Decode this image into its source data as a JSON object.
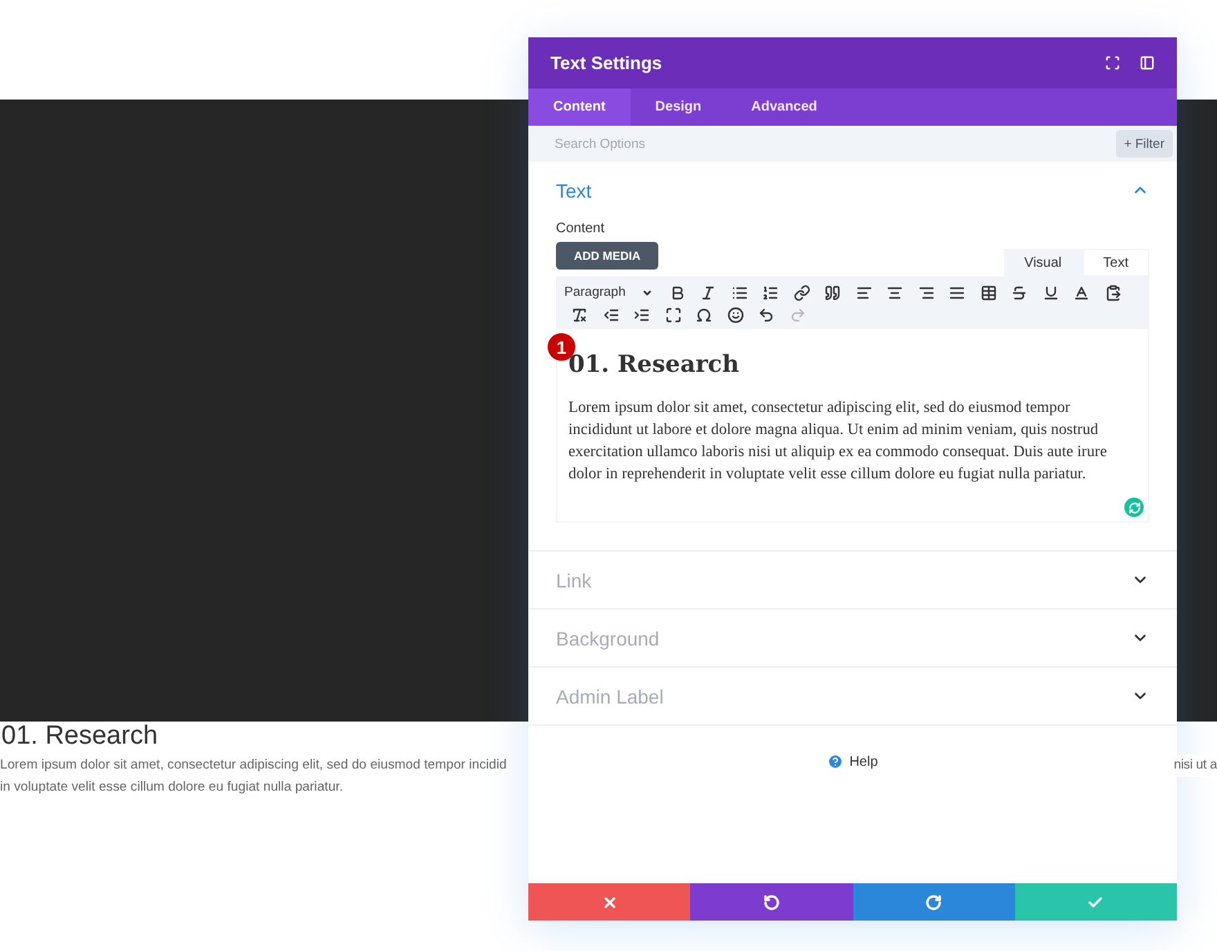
{
  "background_page": {
    "heading": "01. Research",
    "paragraph_lines": [
      "Lorem ipsum dolor sit amet, consectetur adipiscing elit, sed do eiusmod tempor incidid",
      "in voluptate velit esse cillum dolore eu fugiat nulla pariatur."
    ],
    "paragraph_fragment": "nisi ut a"
  },
  "modal": {
    "title": "Text Settings",
    "tabs": [
      {
        "label": "Content",
        "selected": true
      },
      {
        "label": "Design",
        "selected": false
      },
      {
        "label": "Advanced",
        "selected": false
      }
    ],
    "search": {
      "placeholder": "Search Options"
    },
    "filter_button": "+ Filter",
    "sections": [
      {
        "title": "Text",
        "expanded": true
      },
      {
        "title": "Link",
        "expanded": false
      },
      {
        "title": "Background",
        "expanded": false
      },
      {
        "title": "Admin Label",
        "expanded": false
      }
    ],
    "content_label": "Content",
    "add_media": "ADD MEDIA",
    "editor_tabs": [
      {
        "label": "Visual",
        "selected": true
      },
      {
        "label": "Text",
        "selected": false
      }
    ],
    "format_select": "Paragraph",
    "redo": {
      "disabled": true
    },
    "badge": "1",
    "editor_heading": "01. Research",
    "editor_paragraph": "Lorem ipsum dolor sit amet, consectetur adipiscing elit, sed do eiusmod tempor incididunt ut labore et dolore magna aliqua. Ut enim ad minim veniam, quis nostrud exercitation ullamco laboris nisi ut aliquip ex ea commodo consequat. Duis aute irure dolor in reprehenderit in voluptate velit esse cillum dolore eu fugiat nulla pariatur.",
    "help": "Help",
    "footer_buttons": [
      {
        "kind": "cancel",
        "color": "#ef5555"
      },
      {
        "kind": "undo",
        "color": "#7e3bd0"
      },
      {
        "kind": "redo",
        "color": "#2b87da"
      },
      {
        "kind": "save",
        "color": "#29c4a9"
      }
    ]
  }
}
